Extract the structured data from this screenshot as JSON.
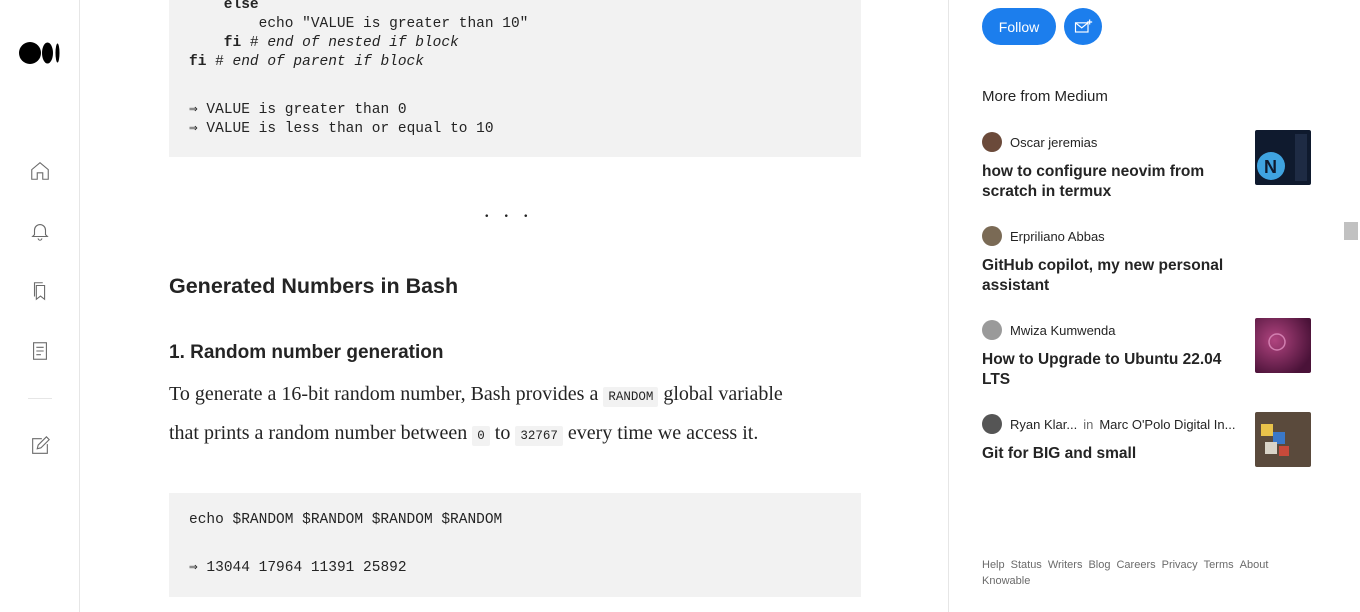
{
  "rail": {
    "icons": [
      "home-icon",
      "bell-icon",
      "bookmarks-icon",
      "stories-icon",
      "write-icon"
    ]
  },
  "article": {
    "code_top": {
      "lines": [
        {
          "kw": "",
          "text": "    else",
          "comment": ""
        },
        {
          "kw": "",
          "text": "        echo \"VALUE is greater than 10\"",
          "comment": ""
        },
        {
          "kw": "    fi",
          "text": " # ",
          "comment": "end of nested if block"
        },
        {
          "kw": "fi",
          "text": " # ",
          "comment": "end of parent if block"
        }
      ],
      "output": [
        "⇒ VALUE is greater than 0",
        "⇒ VALUE is less than or equal to 10"
      ]
    },
    "separator": "...",
    "heading": "Generated Numbers in Bash",
    "subheading": "1. Random number generation",
    "para": {
      "p1": "To generate a 16-bit random number, Bash provides a ",
      "code1": "RANDOM",
      "p2": " global variable",
      "p3": "that prints a random number between ",
      "code2": "0",
      "p4": " to ",
      "code3": "32767",
      "p5": " every time we access it."
    },
    "code_bottom": {
      "command": "echo $RANDOM $RANDOM $RANDOM $RANDOM",
      "output": "⇒ 13044 17964 11391 25892"
    }
  },
  "sidebar": {
    "follow_label": "Follow",
    "more_title": "More from Medium",
    "stories": [
      {
        "author": "Oscar jeremias",
        "publication": "",
        "title": "how to configure neovim from scratch in termux",
        "avatar_color": "#6b4a3a",
        "thumb_color": "#0f1a2e",
        "has_thumb": true
      },
      {
        "author": "Erpriliano Abbas",
        "publication": "",
        "title": "GitHub copilot, my new personal assistant",
        "avatar_color": "#7a6a55",
        "thumb_color": "",
        "has_thumb": false
      },
      {
        "author": "Mwiza Kumwenda",
        "publication": "",
        "title": "How to Upgrade to Ubuntu 22.04 LTS",
        "avatar_color": "#9a9a9a",
        "thumb_color": "#6a1e52",
        "has_thumb": true
      },
      {
        "author": "Ryan Klar...",
        "publication": "Marc O'Polo Digital In...",
        "in_label": "in",
        "title": "Git for BIG and small",
        "avatar_color": "#555555",
        "thumb_color": "#5a4a3c",
        "has_thumb": true
      }
    ],
    "footer_links": [
      "Help",
      "Status",
      "Writers",
      "Blog",
      "Careers",
      "Privacy",
      "Terms",
      "About",
      "Knowable"
    ]
  }
}
